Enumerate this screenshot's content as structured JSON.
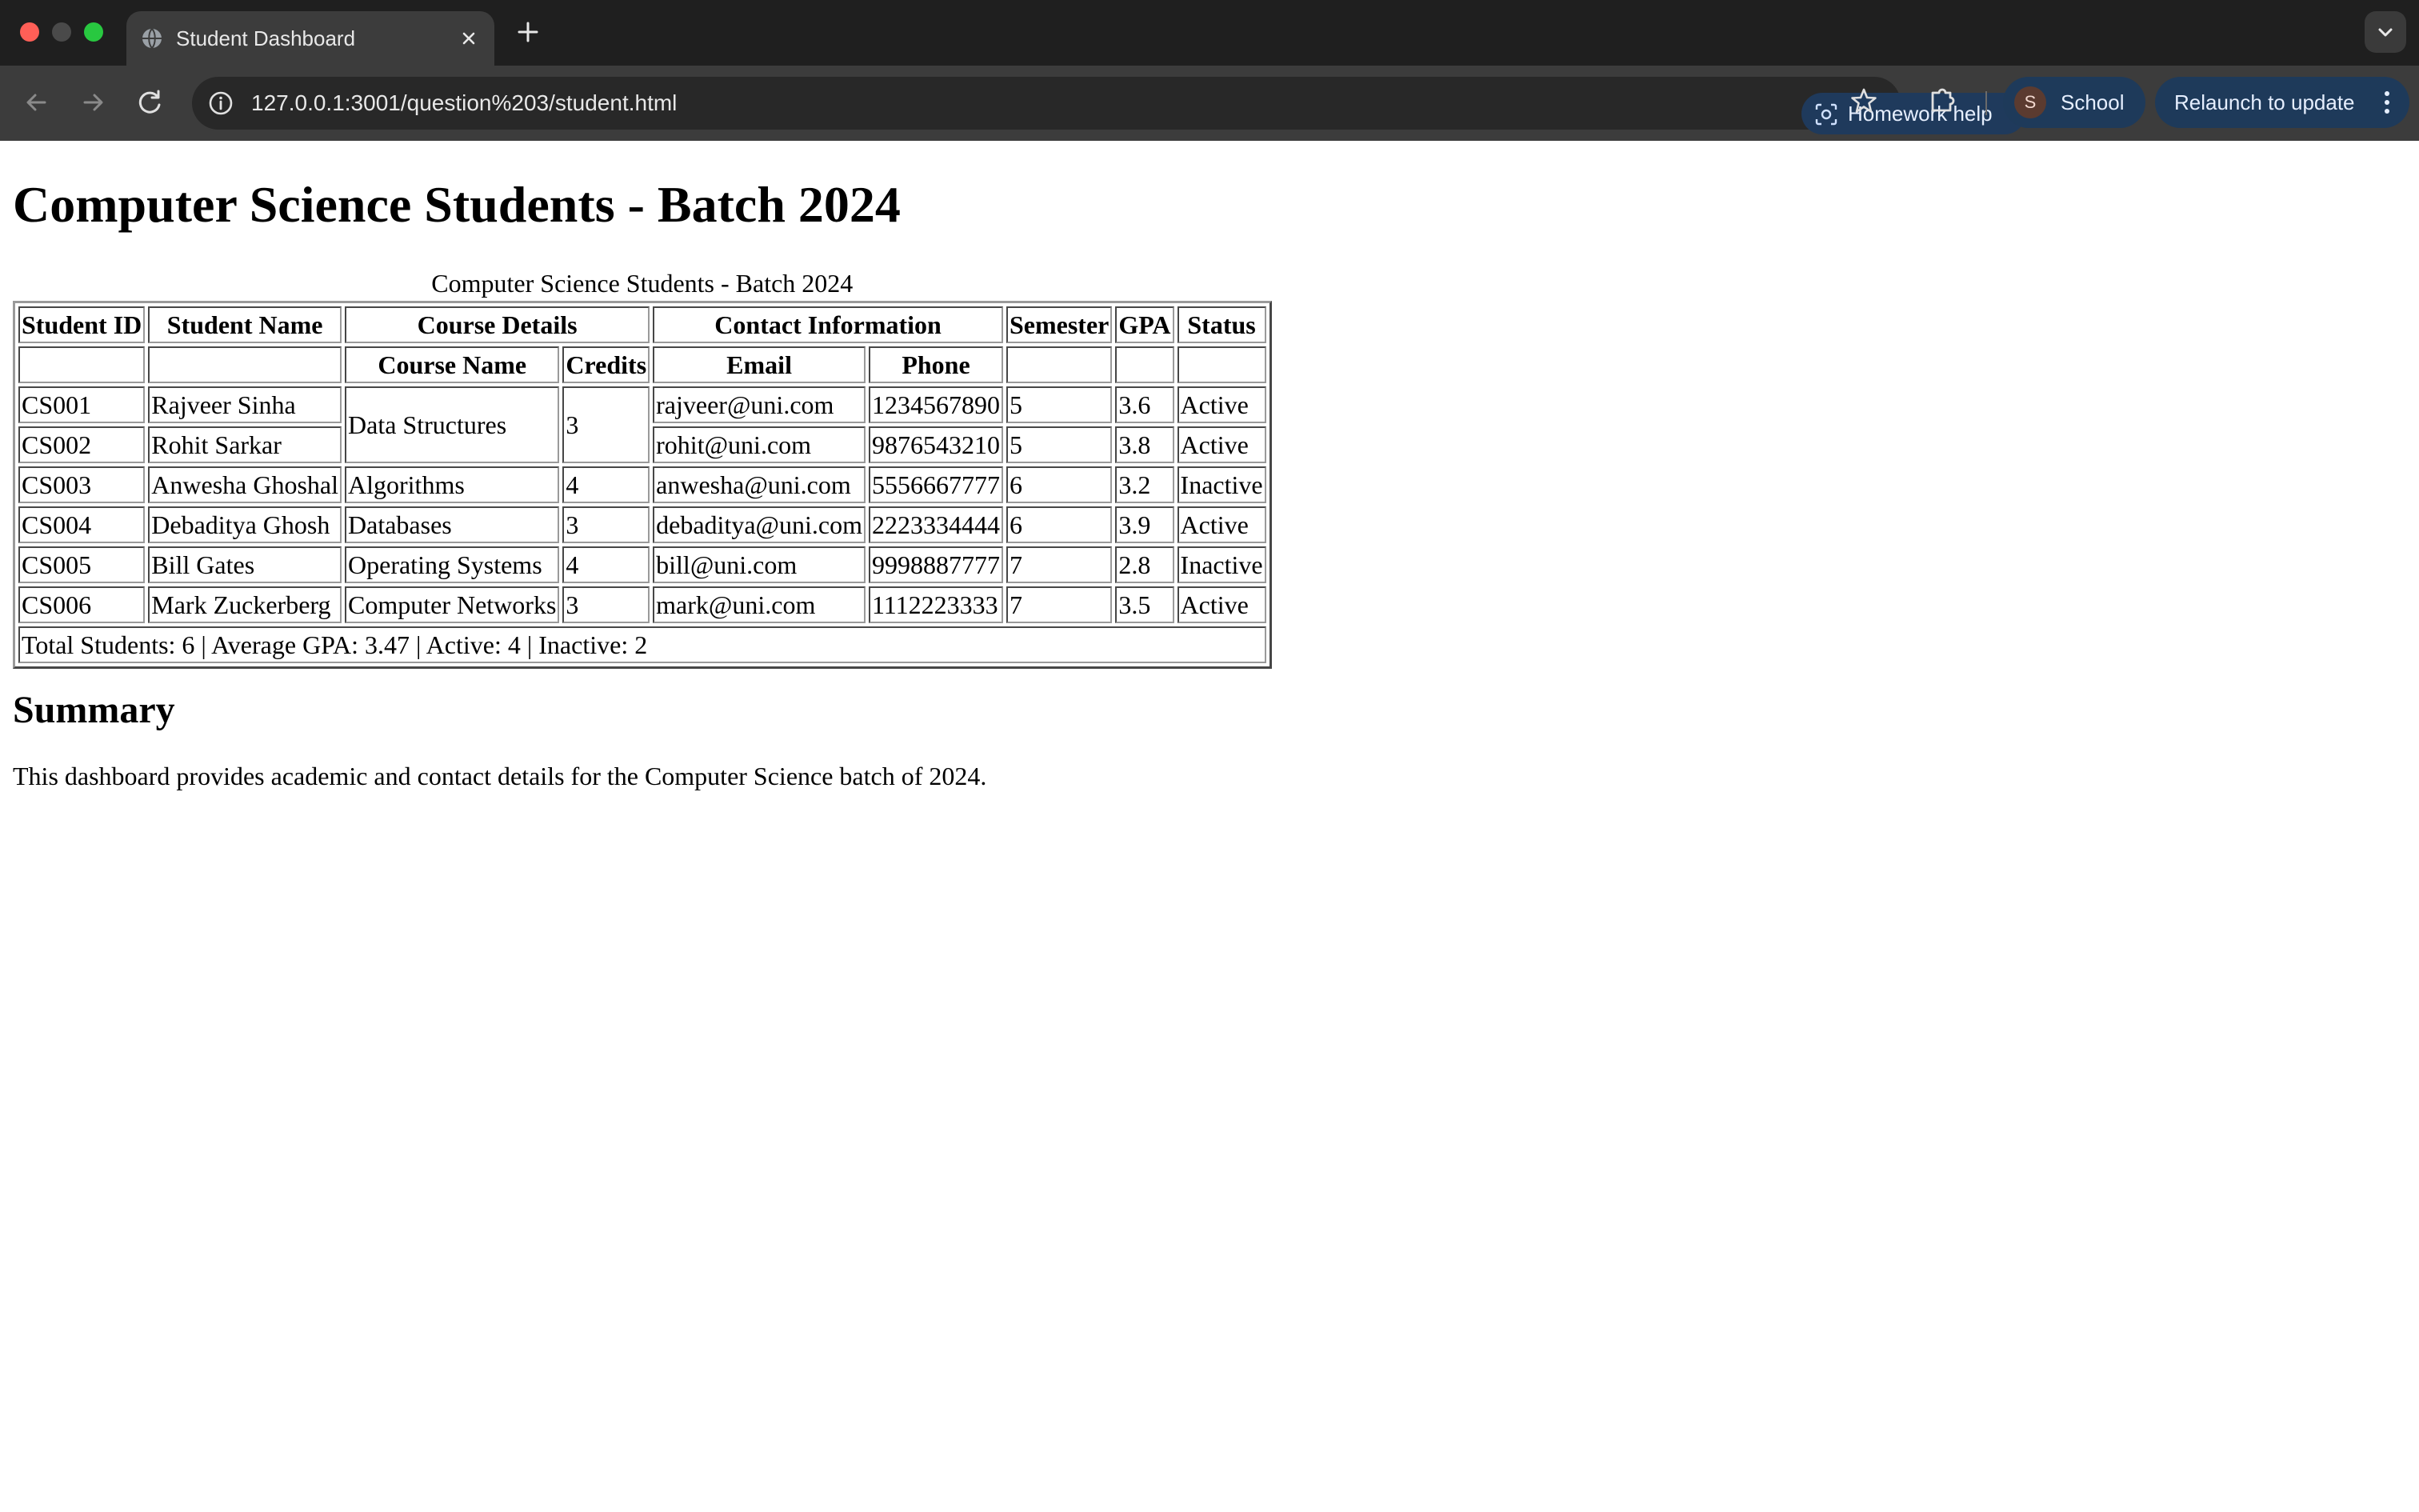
{
  "browser": {
    "tab_title": "Student Dashboard",
    "url": "127.0.0.1:3001/question%203/student.html",
    "homework_help_label": "Homework help",
    "profile_initial": "S",
    "profile_label": "School",
    "relaunch_label": "Relaunch to update",
    "colors": {
      "tabstrip": "#1f1f1f",
      "toolbar": "#3c3c3c",
      "accent_pill": "#1e3a5a"
    },
    "icons": [
      "globe-icon",
      "close-icon",
      "plus-icon",
      "chevron-down-icon",
      "back-arrow-icon",
      "forward-arrow-icon",
      "reload-icon",
      "info-icon",
      "lens-icon",
      "star-icon",
      "puzzle-icon",
      "kebab-menu-icon"
    ]
  },
  "page": {
    "heading": "Computer Science Students - Batch 2024",
    "table": {
      "caption": "Computer Science Students - Batch 2024",
      "header_groups": {
        "student_id": "Student ID",
        "student_name": "Student Name",
        "course_details": "Course Details",
        "contact_information": "Contact Information",
        "semester": "Semester",
        "gpa": "GPA",
        "status": "Status"
      },
      "sub_headers": {
        "course_name": "Course Name",
        "credits": "Credits",
        "email": "Email",
        "phone": "Phone"
      },
      "rows": [
        {
          "id": "CS001",
          "name": "Rajveer Sinha",
          "course": "Data Structures",
          "credits": "3",
          "email": "rajveer@uni.com",
          "phone": "1234567890",
          "semester": "5",
          "gpa": "3.6",
          "status": "Active"
        },
        {
          "id": "CS002",
          "name": "Rohit Sarkar",
          "email": "rohit@uni.com",
          "phone": "9876543210",
          "semester": "5",
          "gpa": "3.8",
          "status": "Active"
        },
        {
          "id": "CS003",
          "name": "Anwesha Ghoshal",
          "course": "Algorithms",
          "credits": "4",
          "email": "anwesha@uni.com",
          "phone": "5556667777",
          "semester": "6",
          "gpa": "3.2",
          "status": "Inactive"
        },
        {
          "id": "CS004",
          "name": "Debaditya Ghosh",
          "course": "Databases",
          "credits": "3",
          "email": "debaditya@uni.com",
          "phone": "2223334444",
          "semester": "6",
          "gpa": "3.9",
          "status": "Active"
        },
        {
          "id": "CS005",
          "name": "Bill Gates",
          "course": "Operating Systems",
          "credits": "4",
          "email": "bill@uni.com",
          "phone": "9998887777",
          "semester": "7",
          "gpa": "2.8",
          "status": "Inactive"
        },
        {
          "id": "CS006",
          "name": "Mark Zuckerberg",
          "course": "Computer Networks",
          "credits": "3",
          "email": "mark@uni.com",
          "phone": "1112223333",
          "semester": "7",
          "gpa": "3.5",
          "status": "Active"
        }
      ],
      "footer": "Total Students: 6 | Average GPA: 3.47 | Active: 4 | Inactive: 2"
    },
    "summary_heading": "Summary",
    "summary_text": "This dashboard provides academic and contact details for the Computer Science batch of 2024."
  }
}
